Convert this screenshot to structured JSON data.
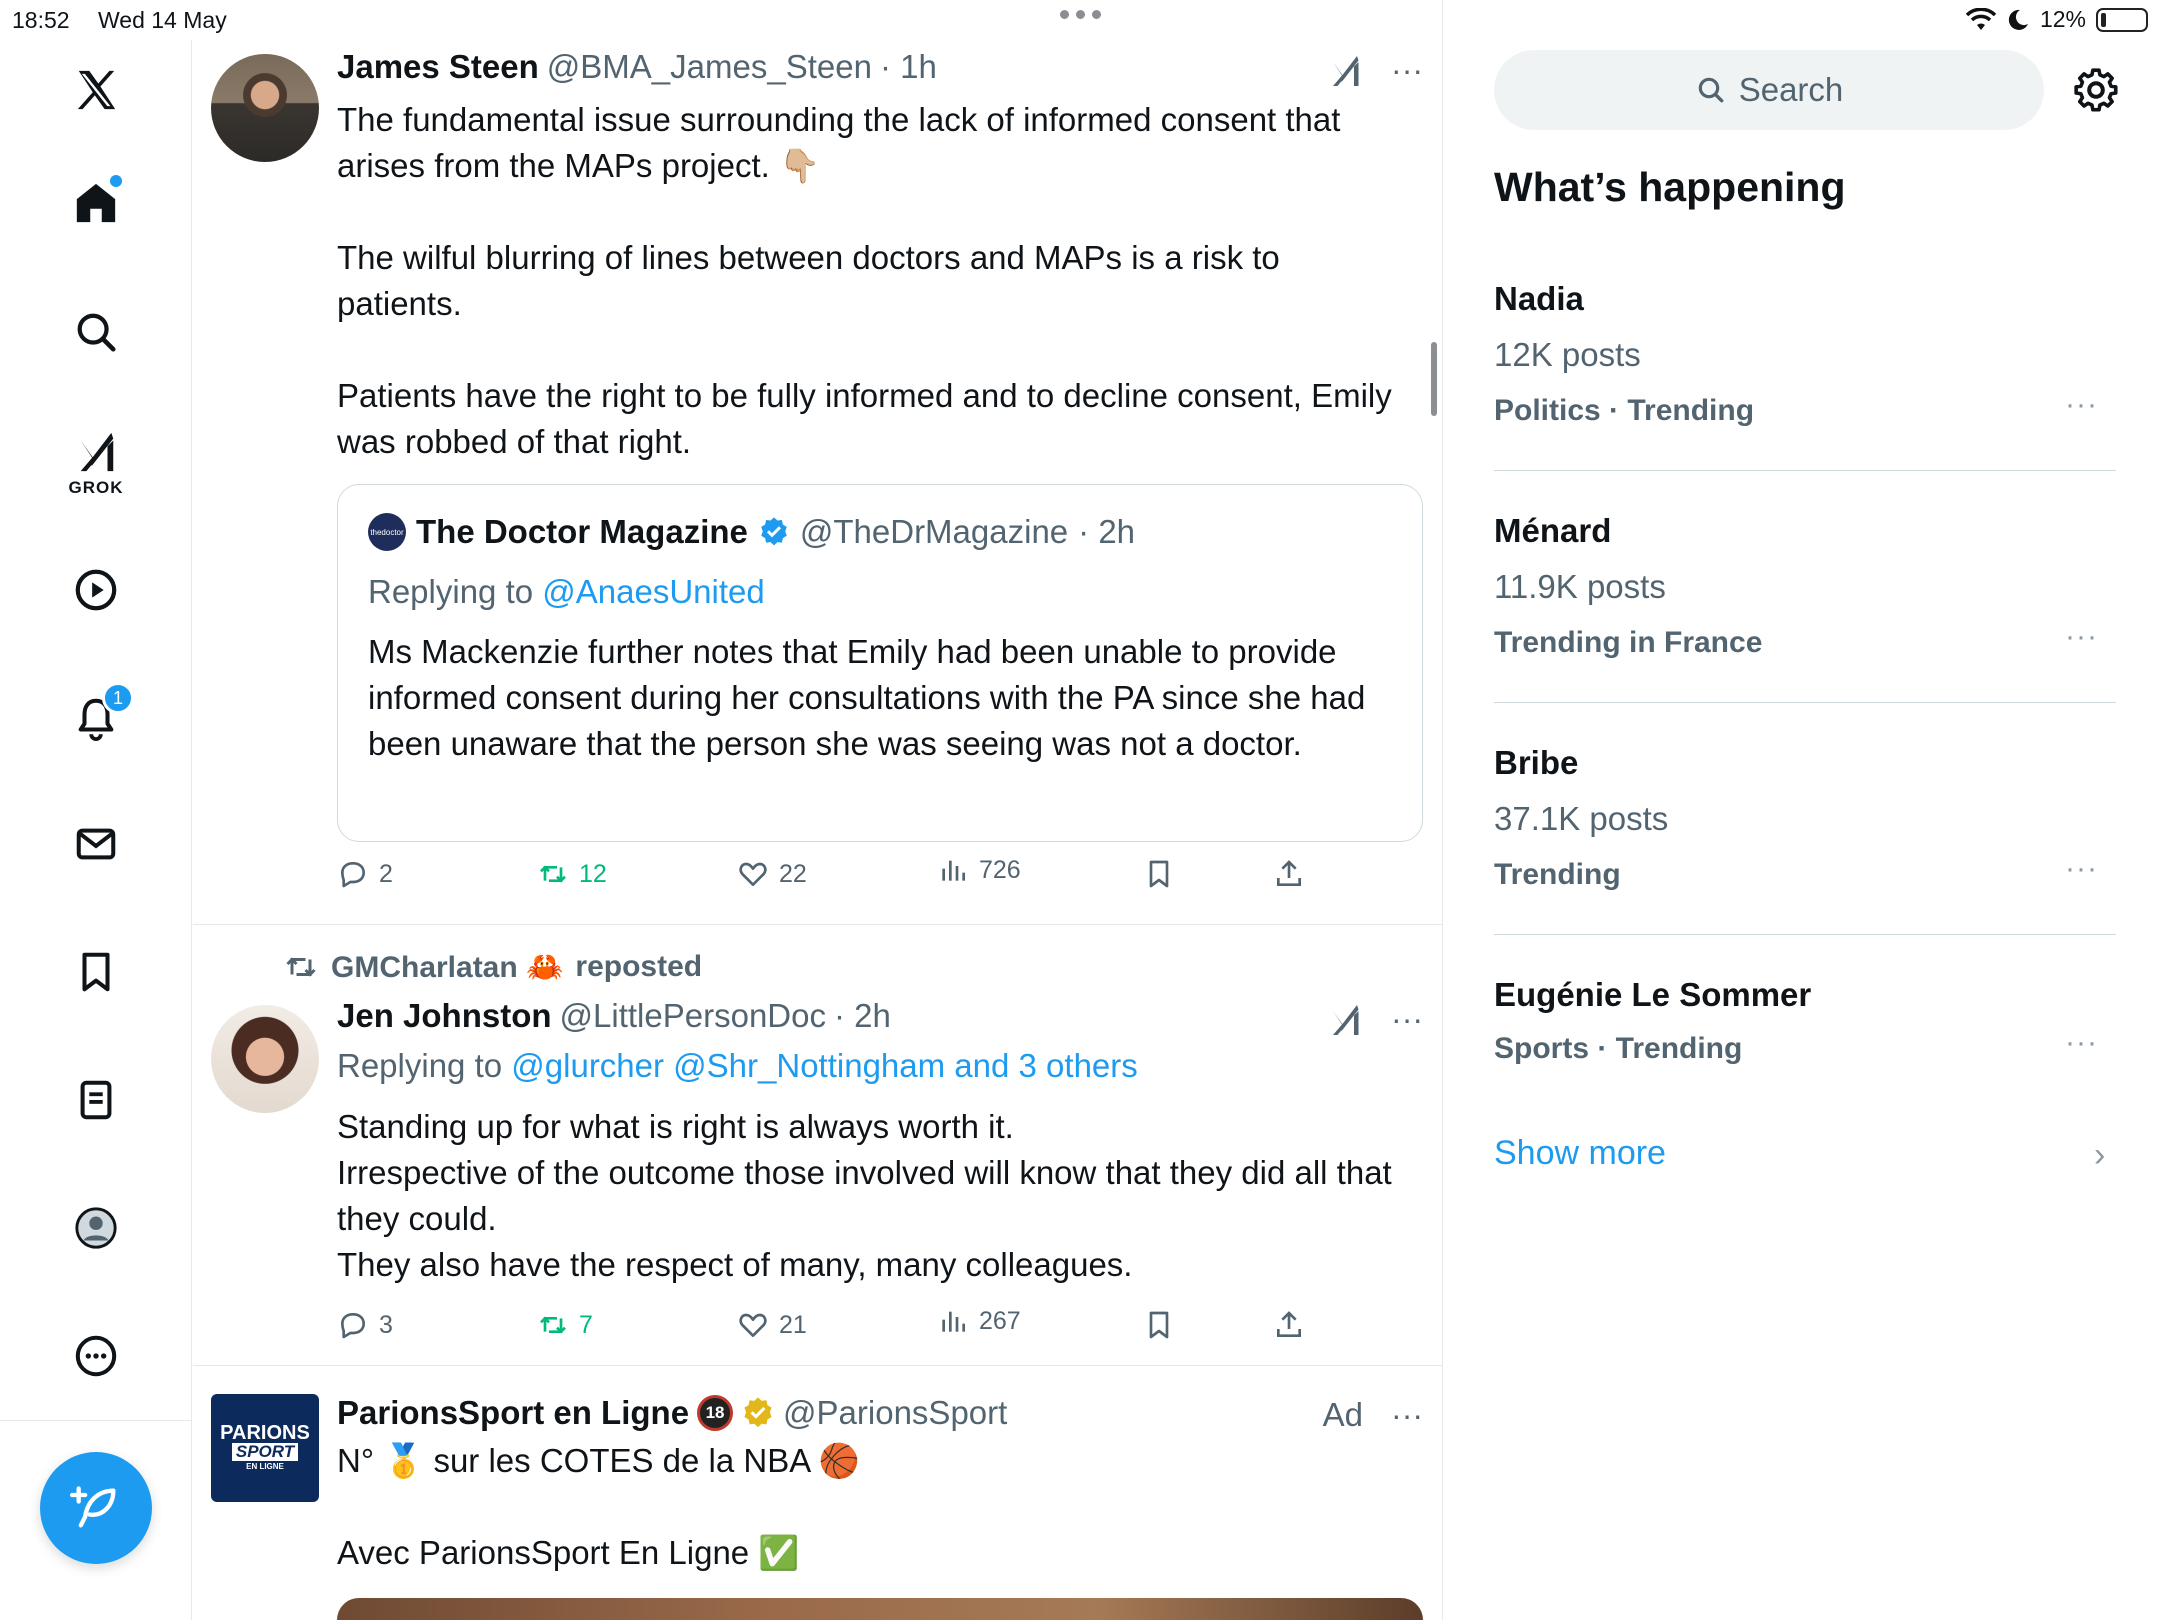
{
  "status_bar": {
    "time": "18:52",
    "date": "Wed 14 May",
    "battery": "12%",
    "battery_level": 0.12
  },
  "nav": {
    "grok_label": "GROK",
    "notifications_badge": "1",
    "items": [
      "x-logo",
      "home",
      "explore",
      "grok",
      "video",
      "notifications",
      "messages",
      "bookmarks",
      "lists",
      "profile",
      "more"
    ]
  },
  "timeline": {
    "posts": [
      {
        "name": "James Steen",
        "handle": "@BMA_James_Steen",
        "time": "· 1h",
        "text": "The fundamental issue surrounding the lack of informed consent that arises from the MAPs project. 👇🏼\n\nThe wilful blurring of lines between doctors and MAPs is a risk to patients.\n\nPatients have the right to be fully informed and to decline consent, Emily was robbed of that right.",
        "quote": {
          "avatar_text": "thedoctor",
          "name": "The Doctor Magazine",
          "handle": "@TheDrMagazine",
          "time": "· 2h",
          "reply_prefix": "Replying to",
          "reply_to": "@AnaesUnited",
          "text": "Ms Mackenzie further notes that Emily had been unable to provide informed consent during her consultations with the PA since she had been unaware that the person she was seeing was not a doctor."
        },
        "stats": {
          "replies": "2",
          "reposts": "12",
          "likes": "22",
          "views": "726"
        }
      },
      {
        "reposted_by": "GMCharlatan 🦀",
        "reposted_suffix": "reposted",
        "name": "Jen Johnston",
        "handle": "@LittlePersonDoc",
        "time": "· 2h",
        "reply_prefix": "Replying to",
        "reply_to": "@glurcher @Shr_Nottingham and 3 others",
        "text": "Standing up for what is right is always worth it.\nIrrespective of the outcome those involved will know that they did all that they could.\nThey also have the respect of many, many colleagues.",
        "stats": {
          "replies": "3",
          "reposts": "7",
          "likes": "21",
          "views": "267"
        }
      },
      {
        "name": "ParionsSport en Ligne",
        "age_badge": "18",
        "handle": "@ParionsSport",
        "ad_label": "Ad",
        "logo_line1": "PARIONS",
        "logo_line2": "SPORT",
        "logo_line3": "EN LIGNE",
        "text": "N° 🥇 sur les COTES de la NBA 🏀\n\nAvec ParionsSport En Ligne ✅"
      }
    ]
  },
  "sidebar": {
    "search_placeholder": "Search",
    "section_title": "What’s happening",
    "trends": [
      {
        "name": "Nadia",
        "posts": "12K posts",
        "meta": "Politics · Trending"
      },
      {
        "name": "Ménard",
        "posts": "11.9K posts",
        "meta": "Trending in France"
      },
      {
        "name": "Bribe",
        "posts": "37.1K posts",
        "meta": "Trending"
      },
      {
        "name": "Eugénie Le Sommer",
        "posts": "",
        "meta": "Sports · Trending"
      }
    ],
    "show_more": "Show more"
  },
  "colors": {
    "accent": "#1d9bf0",
    "retweet": "#00ba7c",
    "muted": "#536471"
  }
}
